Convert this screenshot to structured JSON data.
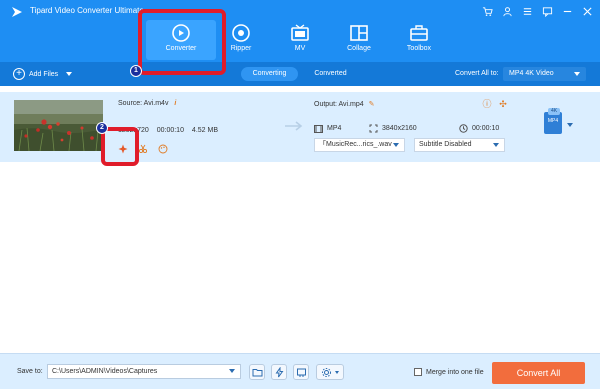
{
  "app": {
    "title": "Tipard Video Converter Ultimate",
    "brand_color": "#1e8ef3"
  },
  "window_icons": [
    "cart-icon",
    "user-icon",
    "menu-icon",
    "chat-icon",
    "minimize-icon",
    "close-icon"
  ],
  "nav": {
    "items": [
      {
        "label": "Converter",
        "icon": "converter-icon",
        "active": true
      },
      {
        "label": "Ripper",
        "icon": "ripper-icon",
        "active": false
      },
      {
        "label": "MV",
        "icon": "mv-icon",
        "active": false
      },
      {
        "label": "Collage",
        "icon": "collage-icon",
        "active": false
      },
      {
        "label": "Toolbox",
        "icon": "toolbox-icon",
        "active": false
      }
    ]
  },
  "toolbar": {
    "add_files": "Add Files",
    "tab_converting": "Converting",
    "tab_converted": "Converted",
    "convert_all_to": "Convert All to:",
    "format": "MP4 4K Video"
  },
  "file": {
    "source": "Source: Avi.m4v",
    "info": "i",
    "resolution": "1252x720",
    "duration": "00:00:10",
    "size": "4.52 MB",
    "output": "Output: Avi.mp4",
    "out_format": "MP4",
    "out_resolution": "3840x2160",
    "out_duration": "00:00:10",
    "audio_track": "「MusicRec...rics_.wav",
    "subtitle": "Subtitle Disabled",
    "badge_top": "4K",
    "badge_text": "MP4"
  },
  "annotations": {
    "badge_1": "1",
    "badge_2": "2",
    "highlight_color": "#e01c2a"
  },
  "footer": {
    "save_to": "Save to:",
    "path": "C:\\Users\\ADMIN\\Videos\\Captures",
    "merge_label": "Merge into one file",
    "convert_all": "Convert All",
    "convert_color": "#f26d3d"
  }
}
